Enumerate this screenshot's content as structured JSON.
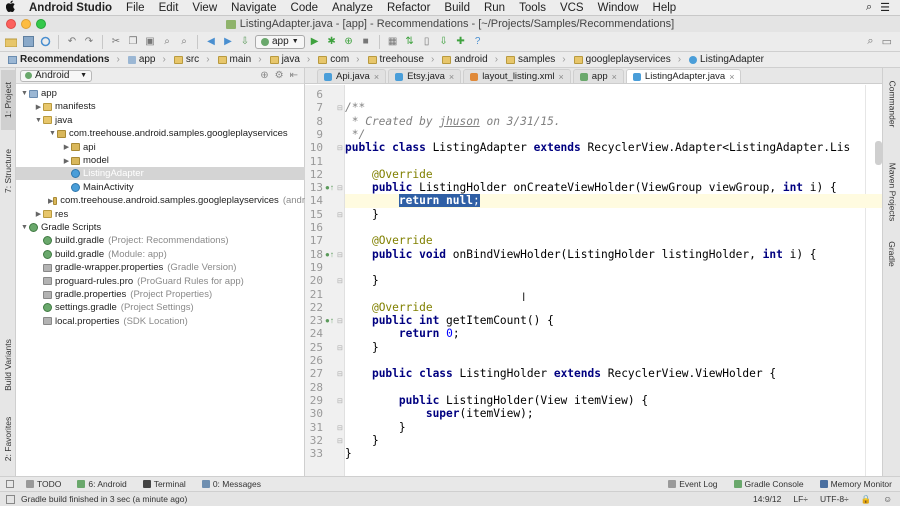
{
  "menubar": {
    "apple": "",
    "app": "Android Studio",
    "items": [
      "File",
      "Edit",
      "View",
      "Navigate",
      "Code",
      "Analyze",
      "Refactor",
      "Build",
      "Run",
      "Tools",
      "VCS",
      "Window",
      "Help"
    ]
  },
  "titlebar": {
    "title": "ListingAdapter.java - [app] - Recommendations - [~/Projects/Samples/Recommendations]"
  },
  "toolbar": {
    "run_config": "app"
  },
  "breadcrumbs": [
    "Recommendations",
    "app",
    "src",
    "main",
    "java",
    "com",
    "treehouse",
    "android",
    "samples",
    "googleplayservices",
    "ListingAdapter"
  ],
  "left_tool_tabs": [
    "1: Project",
    "7: Structure",
    "Build Variants",
    "2: Favorites"
  ],
  "right_tool_tabs": [
    "Commander",
    "Maven Projects",
    "Gradle"
  ],
  "project": {
    "view_mode": "Android",
    "tree": [
      {
        "label": "app",
        "hint": "",
        "icon": "mod",
        "arrow": "▼",
        "depth": 0
      },
      {
        "label": "manifests",
        "hint": "",
        "icon": "folder",
        "arrow": "▶",
        "depth": 1
      },
      {
        "label": "java",
        "hint": "",
        "icon": "folder",
        "arrow": "▼",
        "depth": 1
      },
      {
        "label": "com.treehouse.android.samples.googleplayservices",
        "hint": "",
        "icon": "pkg",
        "arrow": "▼",
        "depth": 2
      },
      {
        "label": "api",
        "hint": "",
        "icon": "pkg",
        "arrow": "▶",
        "depth": 3
      },
      {
        "label": "model",
        "hint": "",
        "icon": "pkg",
        "arrow": "▶",
        "depth": 3
      },
      {
        "label": "ListingAdapter",
        "hint": "",
        "icon": "cls",
        "arrow": "",
        "depth": 3,
        "selected": true
      },
      {
        "label": "MainActivity",
        "hint": "",
        "icon": "cls",
        "arrow": "",
        "depth": 3
      },
      {
        "label": "com.treehouse.android.samples.googleplayservices",
        "hint": "(andr",
        "icon": "pkg",
        "arrow": "▶",
        "depth": 2
      },
      {
        "label": "res",
        "hint": "",
        "icon": "folder",
        "arrow": "▶",
        "depth": 1
      },
      {
        "label": "Gradle Scripts",
        "hint": "",
        "icon": "grad",
        "arrow": "▼",
        "depth": 0
      },
      {
        "label": "build.gradle",
        "hint": "(Project: Recommendations)",
        "icon": "grad",
        "arrow": "",
        "depth": 1
      },
      {
        "label": "build.gradle",
        "hint": "(Module: app)",
        "icon": "grad",
        "arrow": "",
        "depth": 1
      },
      {
        "label": "gradle-wrapper.properties",
        "hint": "(Gradle Version)",
        "icon": "prop",
        "arrow": "",
        "depth": 1
      },
      {
        "label": "proguard-rules.pro",
        "hint": "(ProGuard Rules for app)",
        "icon": "prop",
        "arrow": "",
        "depth": 1
      },
      {
        "label": "gradle.properties",
        "hint": "(Project Properties)",
        "icon": "prop",
        "arrow": "",
        "depth": 1
      },
      {
        "label": "settings.gradle",
        "hint": "(Project Settings)",
        "icon": "grad",
        "arrow": "",
        "depth": 1
      },
      {
        "label": "local.properties",
        "hint": "(SDK Location)",
        "icon": "prop",
        "arrow": "",
        "depth": 1
      }
    ]
  },
  "editor": {
    "tabs": [
      {
        "label": "Api.java",
        "active": false,
        "color": "#4a9ed9"
      },
      {
        "label": "Etsy.java",
        "active": false,
        "color": "#4a9ed9"
      },
      {
        "label": "layout_listing.xml",
        "active": false,
        "color": "#e08a3a"
      },
      {
        "label": "app",
        "active": false,
        "color": "#6aa86c"
      },
      {
        "label": "ListingAdapter.java",
        "active": true,
        "color": "#4a9ed9"
      }
    ],
    "lines": [
      {
        "n": "6",
        "html": ""
      },
      {
        "n": "7",
        "html": "<span class=\"cm\">/**</span>"
      },
      {
        "n": "8",
        "html": "<span class=\"cm\"> * Created by <span class=\"ul\">jhuson</span> on 3/31/15.</span>"
      },
      {
        "n": "9",
        "html": "<span class=\"cm\"> */</span>"
      },
      {
        "n": "10",
        "html": "<span class=\"kw\">public class</span> ListingAdapter <span class=\"kw\">extends</span> RecyclerView.Adapter&lt;ListingAdapter.Lis"
      },
      {
        "n": "11",
        "html": ""
      },
      {
        "n": "12",
        "html": "    <span class=\"an\">@Override</span>"
      },
      {
        "n": "13",
        "html": "    <span class=\"kw\">public</span> ListingHolder onCreateViewHolder(ViewGroup viewGroup, <span class=\"kw\">int</span> i) {"
      },
      {
        "n": "14",
        "html": "        <span class=\"sel\"><b>return null</b>;</span>",
        "hl": true
      },
      {
        "n": "15",
        "html": "    }"
      },
      {
        "n": "16",
        "html": ""
      },
      {
        "n": "17",
        "html": "    <span class=\"an\">@Override</span>"
      },
      {
        "n": "18",
        "html": "    <span class=\"kw\">public void</span> onBindViewHolder(ListingHolder listingHolder, <span class=\"kw\">int</span> i) {"
      },
      {
        "n": "19",
        "html": ""
      },
      {
        "n": "20",
        "html": "    }"
      },
      {
        "n": "21",
        "html": ""
      },
      {
        "n": "22",
        "html": "    <span class=\"an\">@Override</span>"
      },
      {
        "n": "23",
        "html": "    <span class=\"kw\">public int</span> getItemCount() {"
      },
      {
        "n": "24",
        "html": "        <span class=\"kw\">return</span> <span class=\"num\">0</span>;"
      },
      {
        "n": "25",
        "html": "    }"
      },
      {
        "n": "26",
        "html": ""
      },
      {
        "n": "27",
        "html": "    <span class=\"kw\">public class</span> ListingHolder <span class=\"kw\">extends</span> RecyclerView.ViewHolder {"
      },
      {
        "n": "28",
        "html": ""
      },
      {
        "n": "29",
        "html": "        <span class=\"kw\">public</span> ListingHolder(View itemView) {"
      },
      {
        "n": "30",
        "html": "            <span class=\"kw\">super</span>(itemView);"
      },
      {
        "n": "31",
        "html": "        }"
      },
      {
        "n": "32",
        "html": "    }"
      },
      {
        "n": "33",
        "html": "}"
      }
    ]
  },
  "bottom_tabs": {
    "left": [
      "TODO",
      "6: Android",
      "Terminal",
      "0: Messages"
    ],
    "right": [
      "Event Log",
      "Gradle Console",
      "Memory Monitor"
    ]
  },
  "status": {
    "message": "Gradle build finished in 3 sec (a minute ago)",
    "position": "14:9/12",
    "line_sep": "LF÷",
    "encoding": "UTF-8÷"
  }
}
